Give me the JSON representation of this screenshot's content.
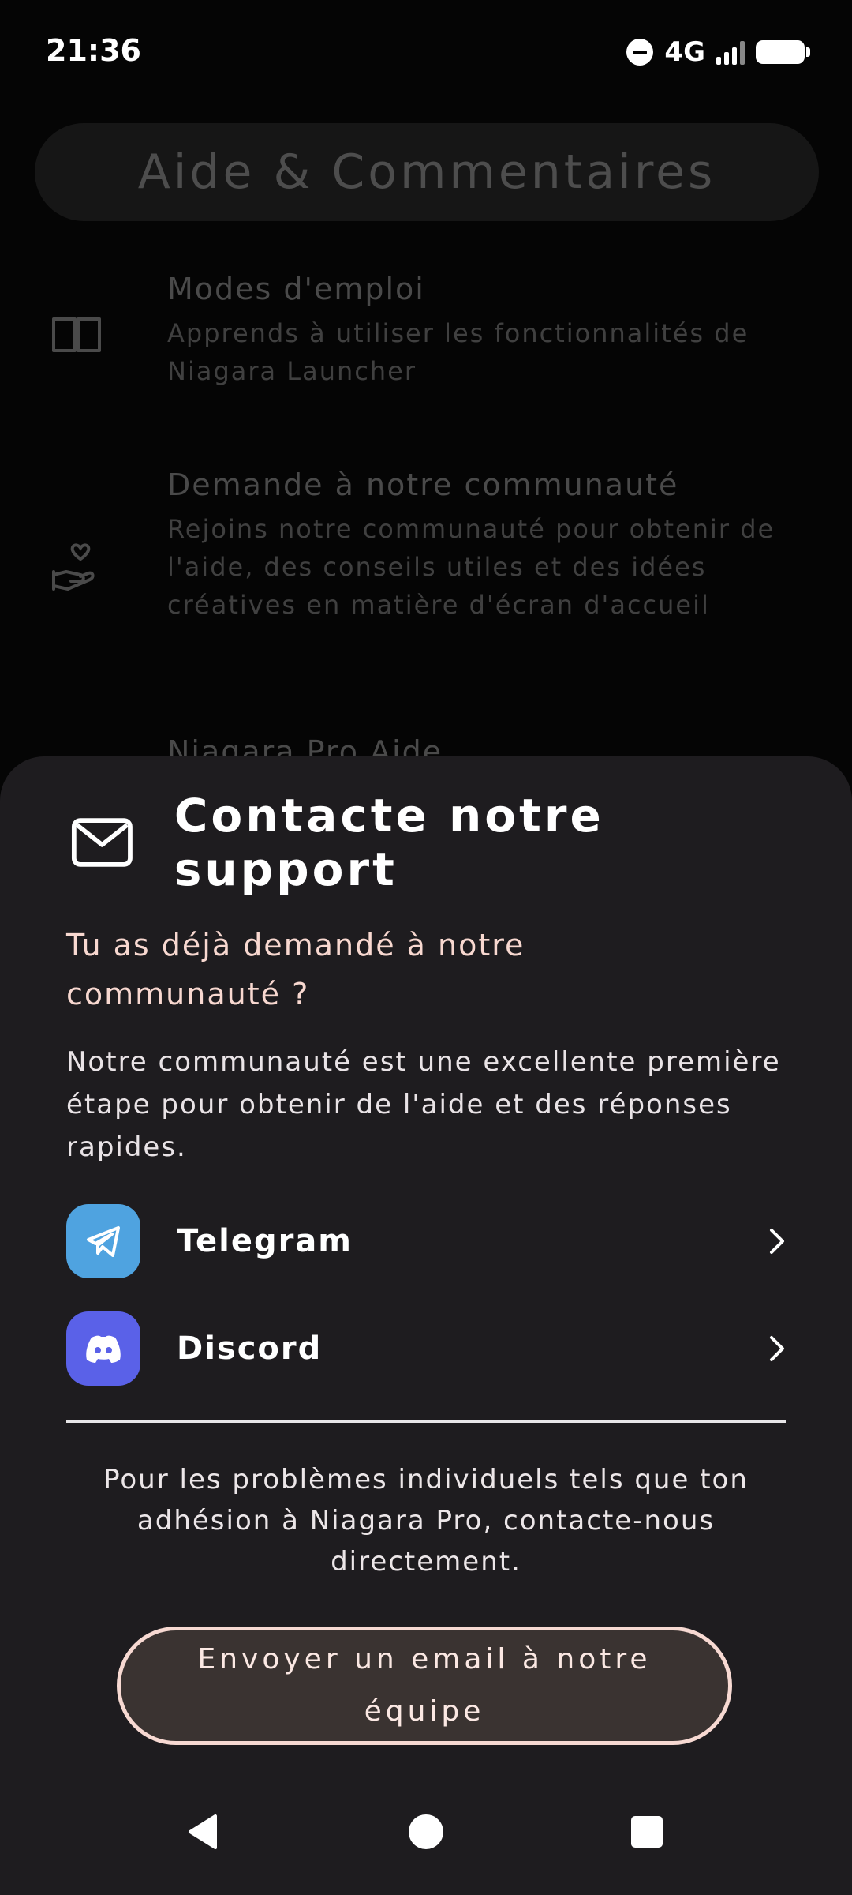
{
  "status_bar": {
    "time": "21:36",
    "network": "4G"
  },
  "background_page": {
    "title": "Aide & Commentaires",
    "items": [
      {
        "icon": "book-icon",
        "title": "Modes d'emploi",
        "description": "Apprends à utiliser les fonctionnalités de Niagara Launcher"
      },
      {
        "icon": "hand-heart-icon",
        "title": "Demande à notre communauté",
        "description": "Rejoins notre communauté pour obtenir de l'aide, des conseils utiles et des idées créatives en matière d'écran d'accueil"
      },
      {
        "icon": "",
        "title": "Niagara Pro Aide",
        "description": ""
      }
    ]
  },
  "sheet": {
    "title": "Contacte notre support",
    "question": "Tu as déjà demandé à notre communauté ?",
    "body": "Notre communauté est une excellente première étape pour obtenir de l'aide et des réponses rapides.",
    "communities": [
      {
        "label": "Telegram",
        "icon": "telegram-icon",
        "color": "#4fa3e0"
      },
      {
        "label": "Discord",
        "icon": "discord-icon",
        "color": "#5a61e8"
      }
    ],
    "footer_note": "Pour les problèmes individuels tels que ton adhésion à Niagara Pro, contacte-nous directement.",
    "email_button": "Envoyer un email à notre équipe"
  },
  "colors": {
    "sheet_background": "#1e1c1f",
    "accent_pink": "#f7d9d2",
    "button_fill": "#3a3331"
  }
}
